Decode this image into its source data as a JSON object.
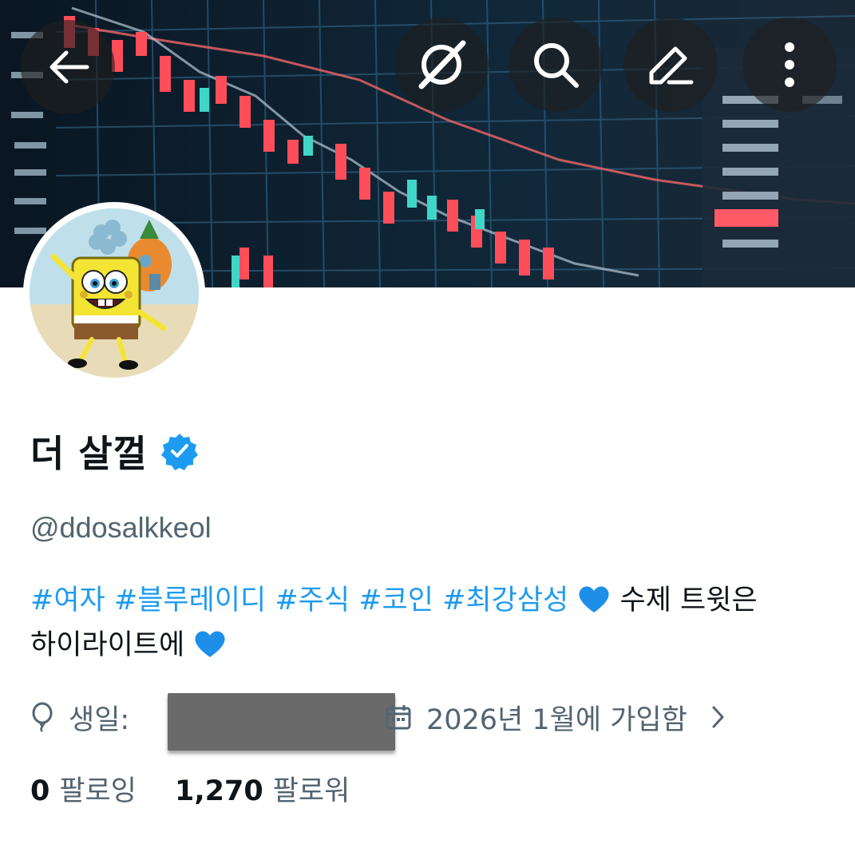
{
  "banner": {
    "description_icon": "stock-chart-banner"
  },
  "toolbar": {
    "back_icon": "arrow-left-icon",
    "grok_icon": "grok-icon",
    "search_icon": "search-icon",
    "edit_icon": "edit-icon",
    "more_icon": "more-vertical-icon"
  },
  "profile": {
    "display_name": "더 살껄",
    "verified": true,
    "handle": "@ddosalkkeol",
    "bio": {
      "tags": [
        "#여자",
        "#블루레이디",
        "#주식",
        "#코인",
        "#최강삼성"
      ],
      "line1_text": "수제 트윗은",
      "line2_text": "하이라이트에"
    },
    "birthday_label": "생일:",
    "joined": "2026년 1월에 가입함",
    "following_count": "0",
    "following_label": "팔로잉",
    "followers_count": "1,270",
    "followers_label": "팔로워"
  },
  "colors": {
    "accent": "#1d9bf0",
    "text_primary": "#0f1419",
    "text_secondary": "#536471",
    "heart": "#1d8fe8"
  }
}
